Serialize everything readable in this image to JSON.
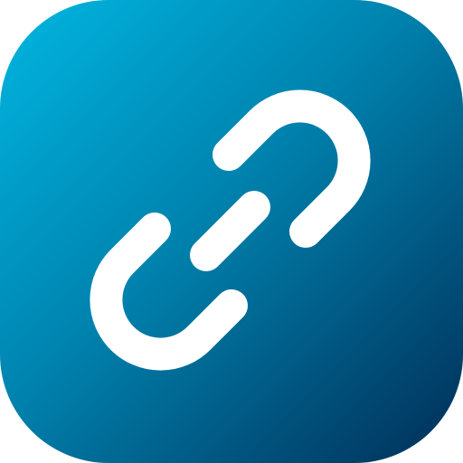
{
  "app_icon": {
    "name": "link-icon",
    "colors": {
      "gradient_start": "#00B7E1",
      "gradient_mid": "#0082AE",
      "gradient_end": "#002E57",
      "glyph": "#FFFFFF"
    }
  }
}
